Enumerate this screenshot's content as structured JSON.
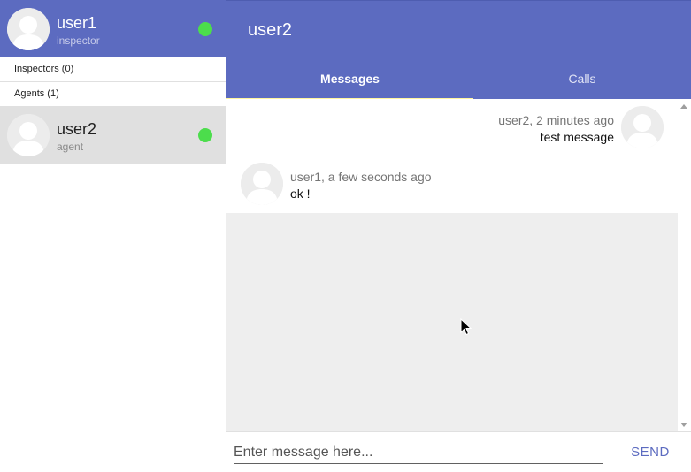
{
  "current_user": {
    "name": "user1",
    "role": "inspector",
    "status_color": "#4cdd4c"
  },
  "groups": [
    {
      "label": "Inspectors (0)"
    },
    {
      "label": "Agents (1)"
    }
  ],
  "contacts": [
    {
      "name": "user2",
      "role": "agent",
      "status_color": "#4cdd4c",
      "selected": true
    }
  ],
  "conversation": {
    "title": "user2",
    "tabs": [
      {
        "label": "Messages",
        "active": true
      },
      {
        "label": "Calls",
        "active": false
      }
    ],
    "messages": [
      {
        "meta": "user2, 2 minutes ago",
        "text": "test message",
        "align": "right"
      },
      {
        "meta": "user1, a few seconds ago",
        "text": "ok !",
        "align": "left"
      }
    ]
  },
  "composer": {
    "placeholder": "Enter message here...",
    "value": "",
    "send_label": "SEND"
  },
  "colors": {
    "primary": "#5c6bc0",
    "tab_indicator": "#fff59d",
    "online": "#4cdd4c"
  },
  "icons": {
    "avatar": "user-avatar-icon",
    "status": "online-status-icon"
  }
}
